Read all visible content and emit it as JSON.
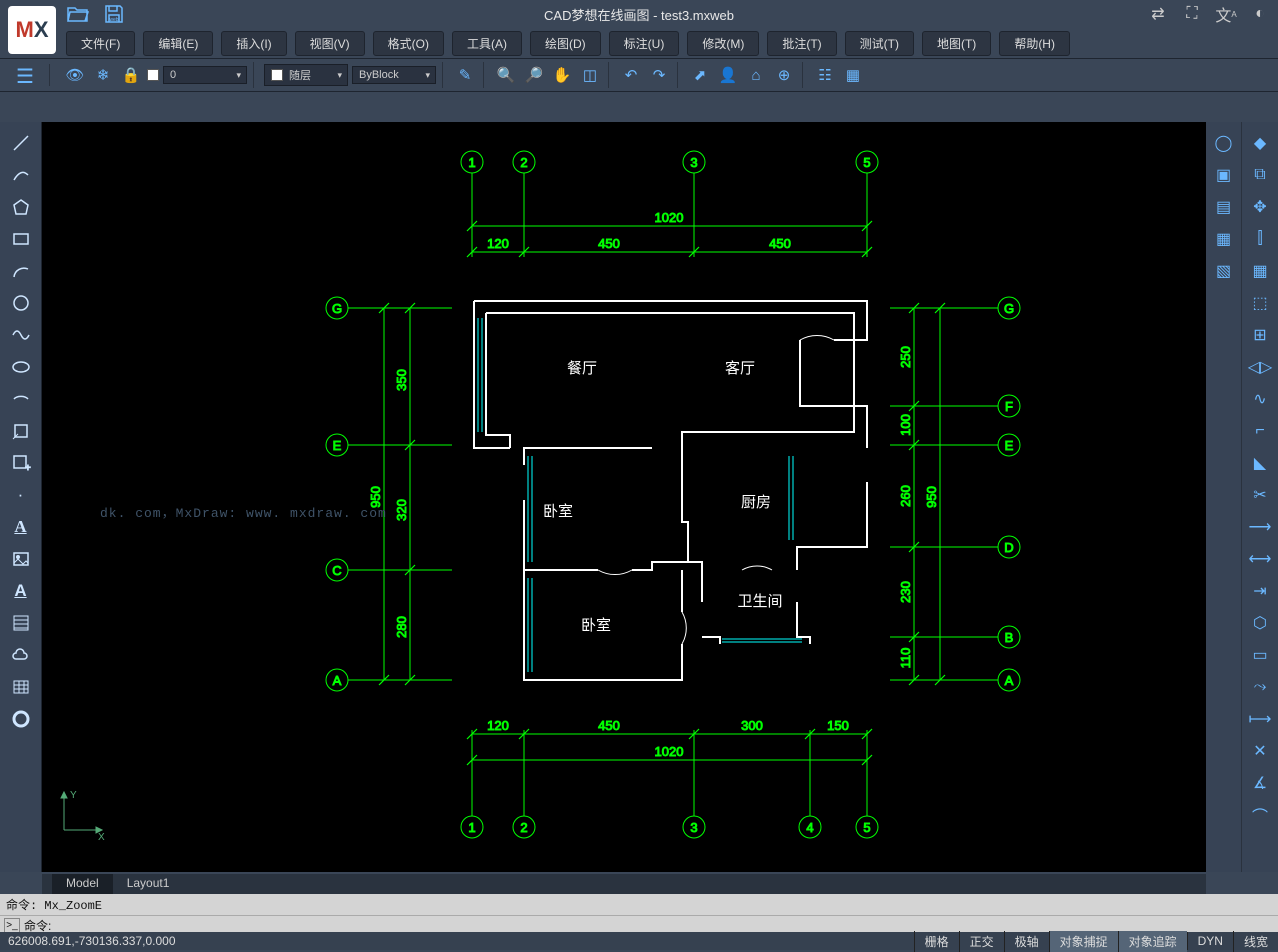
{
  "app": {
    "title": "CAD梦想在线画图 - test3.mxweb"
  },
  "menus": [
    "文件(F)",
    "编辑(E)",
    "插入(I)",
    "视图(V)",
    "格式(O)",
    "工具(A)",
    "绘图(D)",
    "标注(U)",
    "修改(M)",
    "批注(T)",
    "测试(T)",
    "地图(T)",
    "帮助(H)"
  ],
  "layerProps": {
    "zero": "0",
    "layerLabel": "随层",
    "byblock": "ByBlock"
  },
  "tabs": {
    "model": "Model",
    "layout": "Layout1"
  },
  "cmd": {
    "hist": "命令: Mx_ZoomE",
    "prompt": "命令:"
  },
  "status": {
    "coord": "626008.691,-730136.337,0.000",
    "btns": [
      "栅格",
      "正交",
      "极轴",
      "对象捕捉",
      "对象追踪",
      "DYN",
      "线宽"
    ]
  },
  "plan": {
    "rooms": {
      "dining": "餐厅",
      "living": "客厅",
      "bed1": "卧室",
      "kitchen": "厨房",
      "bed2": "卧室",
      "wc": "卫生间"
    },
    "topDims": {
      "total": "1020",
      "s1": "120",
      "s2": "450",
      "s3": "450"
    },
    "botDims": {
      "total": "1020",
      "s1": "120",
      "s2": "450",
      "s3": "300",
      "s4": "150"
    },
    "leftDims": {
      "s1": "350",
      "s2": "320",
      "s3": "280",
      "total": "950"
    },
    "rightDims": {
      "s1": "250",
      "s2": "100",
      "s3": "260",
      "s4": "230",
      "s5": "110",
      "total": "950"
    },
    "gridTop": [
      "1",
      "2",
      "3",
      "5"
    ],
    "gridBot": [
      "1",
      "2",
      "3",
      "4",
      "5"
    ],
    "gridLeft": [
      "G",
      "E",
      "C",
      "A"
    ],
    "gridRight": [
      "G",
      "F",
      "E",
      "D",
      "B",
      "A"
    ]
  },
  "ucs": {
    "x": "X",
    "y": "Y"
  },
  "watermark": "dk. com，MxDraw: www. mxdraw. com"
}
